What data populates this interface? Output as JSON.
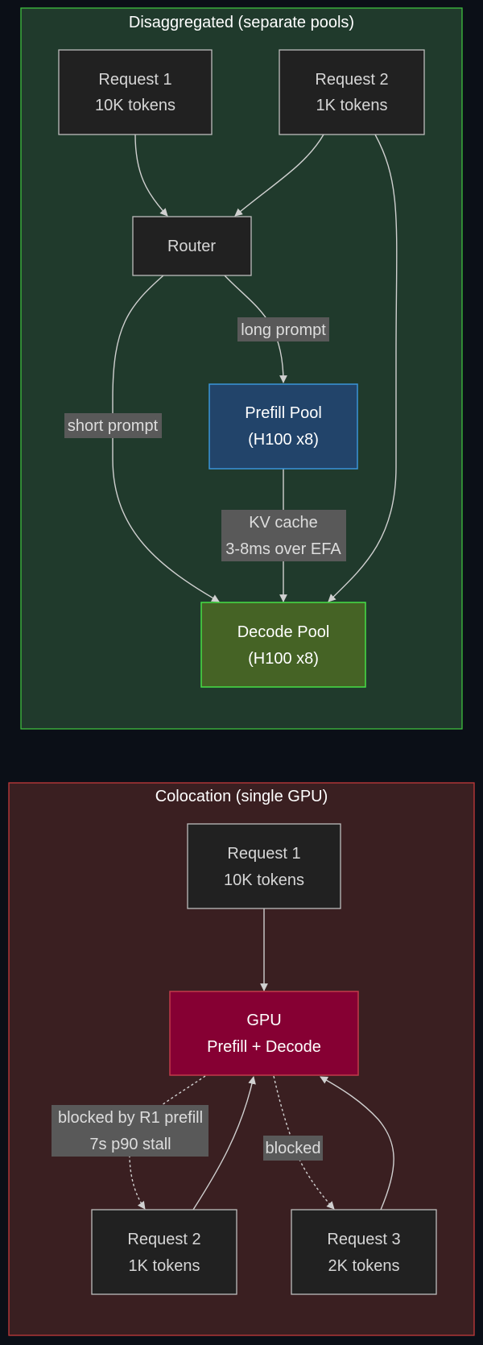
{
  "colors": {
    "background": "#0b0f17",
    "disagg_fill": "#203a2c",
    "disagg_border": "#3fbf3f",
    "coloc_fill": "#3a1f21",
    "coloc_border": "#c23a3a",
    "node_fill": "#212121",
    "node_border": "#bdbdbd",
    "node_text": "#d6d6d6",
    "prefill_fill": "#22446a",
    "prefill_border": "#3b95d8",
    "decode_fill": "#456325",
    "decode_border": "#46e046",
    "gpu_fill": "#860033",
    "gpu_border": "#c23a4a",
    "edge": "#d0d0d0",
    "edge_label_bg": "#595959",
    "edge_label_text": "#dddddd"
  },
  "disaggregated": {
    "title": "Disaggregated (separate pools)",
    "request1": {
      "line1": "Request 1",
      "line2": "10K tokens"
    },
    "request2": {
      "line1": "Request 2",
      "line2": "1K tokens"
    },
    "router": {
      "label": "Router"
    },
    "prefill_pool": {
      "line1": "Prefill Pool",
      "line2": "(H100 x8)"
    },
    "decode_pool": {
      "line1": "Decode Pool",
      "line2": "(H100 x8)"
    },
    "edge_long_prompt": "long prompt",
    "edge_short_prompt": "short prompt",
    "edge_kv_cache": {
      "line1": "KV cache",
      "line2": "3-8ms over EFA"
    }
  },
  "colocation": {
    "title": "Colocation (single GPU)",
    "request1": {
      "line1": "Request 1",
      "line2": "10K tokens"
    },
    "gpu": {
      "line1": "GPU",
      "line2": "Prefill + Decode"
    },
    "request2": {
      "line1": "Request 2",
      "line2": "1K tokens"
    },
    "request3": {
      "line1": "Request 3",
      "line2": "2K tokens"
    },
    "edge_blocked_r1": {
      "line1": "blocked by R1 prefill",
      "line2": "7s p90 stall"
    },
    "edge_blocked": "blocked"
  }
}
